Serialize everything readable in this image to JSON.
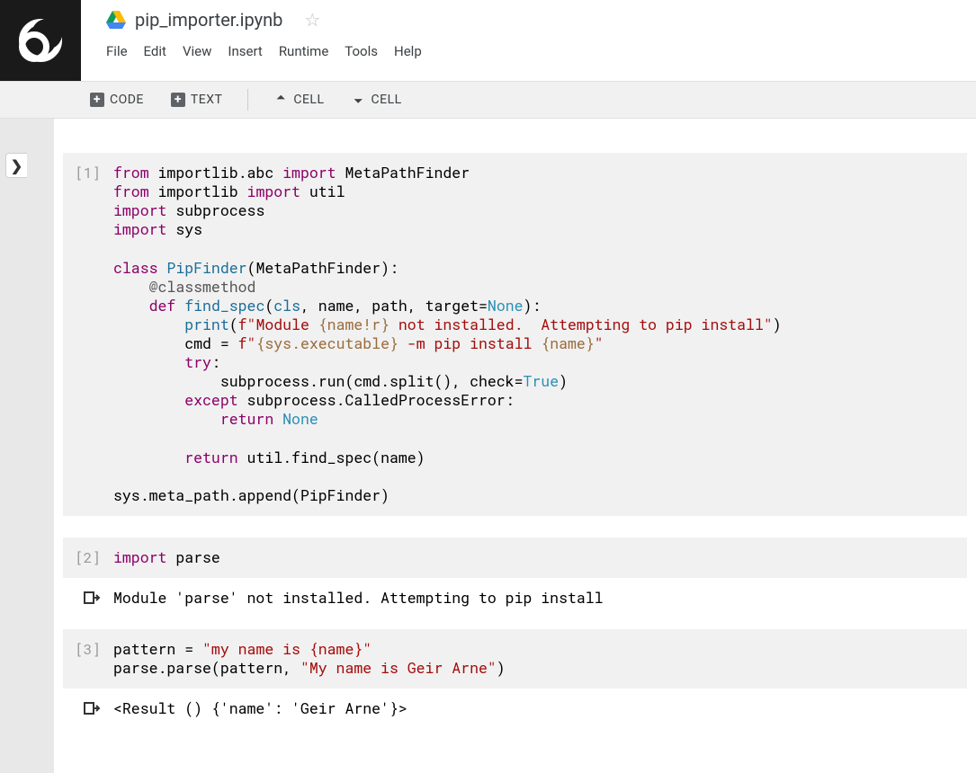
{
  "header": {
    "document_title": "pip_importer.ipynb",
    "star_title": "☆"
  },
  "menu": {
    "file": "File",
    "edit": "Edit",
    "view": "View",
    "insert": "Insert",
    "runtime": "Runtime",
    "tools": "Tools",
    "help": "Help"
  },
  "toolbar": {
    "code": "CODE",
    "text": "TEXT",
    "cell_up": "CELL",
    "cell_down": "CELL"
  },
  "rail": {
    "expand": "❯"
  },
  "cells": {
    "c1": {
      "prompt": "[1]"
    },
    "c2": {
      "prompt": "[2]",
      "output": "Module 'parse' not installed.  Attempting to pip install"
    },
    "c3": {
      "prompt": "[3]",
      "output": "<Result () {'name': 'Geir Arne'}>"
    }
  },
  "code": {
    "c1": {
      "l1_from": "from",
      "l1_mod": "importlib.abc",
      "l1_import": "import",
      "l1_name": "MetaPathFinder",
      "l2_from": "from",
      "l2_mod": "importlib",
      "l2_import": "import",
      "l2_name": "util",
      "l3_import": "import",
      "l3_name": "subprocess",
      "l4_import": "import",
      "l4_name": "sys",
      "l6_class": "class",
      "l6_name": "PipFinder",
      "l6_base": "MetaPathFinder",
      "l7_dec": "@classmethod",
      "l8_def": "def",
      "l8_name": "find_spec",
      "l8_args_cls": "cls",
      "l8_args_rest": ", name, path, target=",
      "l8_none": "None",
      "l9_print": "print",
      "l9_strA": "f\"Module ",
      "l9_interp": "{name!r}",
      "l9_strB": " not installed.  Attempting to pip install\"",
      "l10_var": "cmd = ",
      "l10_strA": "f\"",
      "l10_interp1": "{sys.executable}",
      "l10_strB": " -m pip install ",
      "l10_interp2": "{name}",
      "l10_strC": "\"",
      "l11_try": "try",
      "l12_call": "subprocess.run(cmd.split(), check=",
      "l12_true": "True",
      "l13_except": "except",
      "l13_exc": " subprocess.CalledProcessError:",
      "l14_return": "return",
      "l14_none": "None",
      "l16_return": "return",
      "l16_tail": " util.find_spec(name)",
      "l18": "sys.meta_path.append(PipFinder)"
    },
    "c2": {
      "l1_import": "import",
      "l1_name": " parse"
    },
    "c3": {
      "l1_var": "pattern = ",
      "l1_str": "\"my name is {name}\"",
      "l2_pre": "parse.parse(pattern, ",
      "l2_str": "\"My name is Geir Arne\"",
      "l2_post": ")"
    }
  }
}
